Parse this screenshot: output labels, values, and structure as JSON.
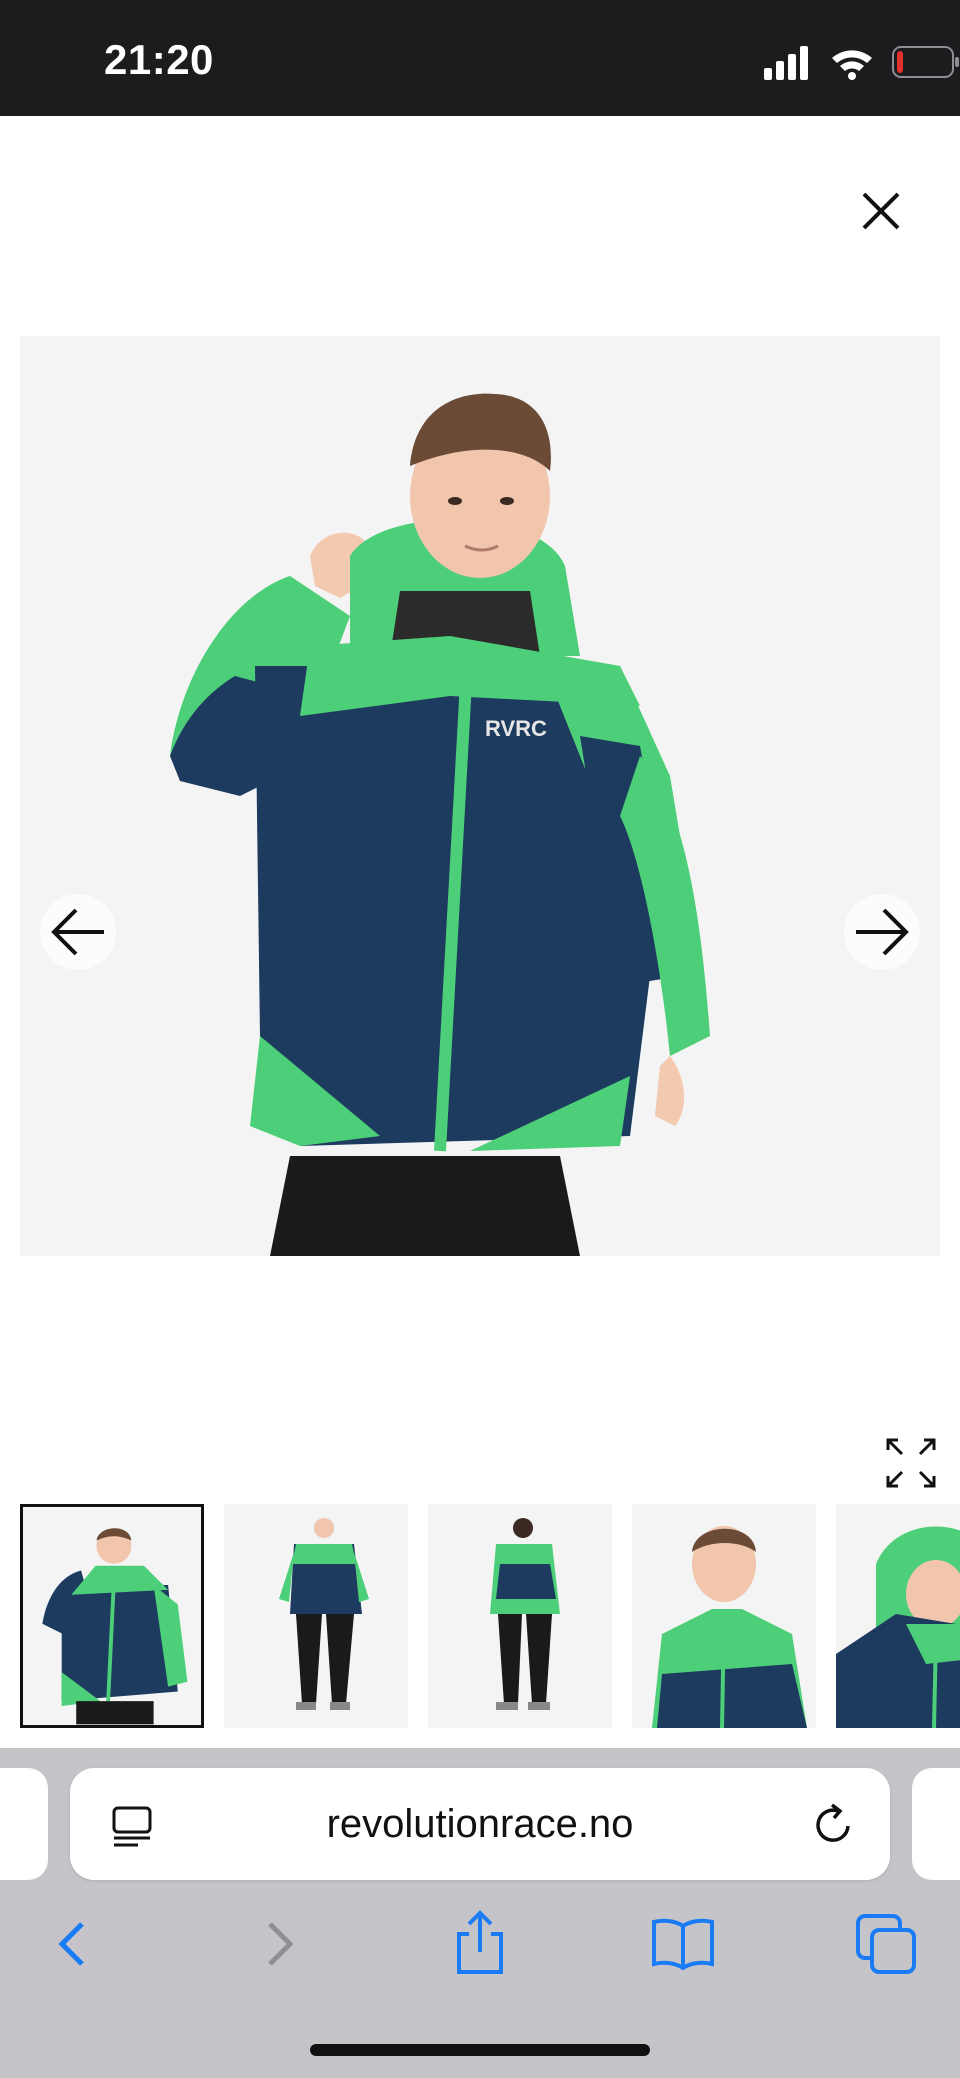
{
  "status_bar": {
    "time": "21:20",
    "icons": [
      "signal-icon",
      "wifi-icon",
      "battery-low-icon"
    ]
  },
  "gallery": {
    "close_icon": "close-icon",
    "prev_icon": "arrow-left-icon",
    "next_icon": "arrow-right-icon",
    "expand_icon": "expand-icon",
    "logo_text": "RVRC",
    "thumbnail_count": 5,
    "selected_thumbnail": 1
  },
  "browser": {
    "url": "revolutionrace.no",
    "reader_icon": "reader-mode-icon",
    "reload_icon": "reload-icon",
    "toolbar": [
      "back-icon",
      "forward-icon",
      "share-icon",
      "bookmarks-icon",
      "tabs-icon"
    ]
  },
  "colors": {
    "jacket_navy": "#1d3b5e",
    "jacket_green": "#4ccf78",
    "accent_blue": "#1a7cf5",
    "status_bar": "#1c1c1e",
    "battery_low": "#e0312c"
  }
}
